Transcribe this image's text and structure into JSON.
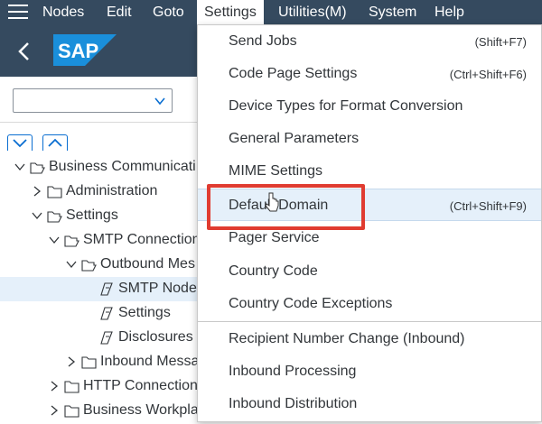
{
  "menubar": {
    "items": [
      {
        "label": "Nodes"
      },
      {
        "label": "Edit"
      },
      {
        "label": "Goto"
      },
      {
        "label": "Settings"
      },
      {
        "label": "Utilities(M)"
      },
      {
        "label": "System"
      },
      {
        "label": "Help"
      }
    ]
  },
  "header": {
    "logo_text": "SAP",
    "brand_color": "#1a8fdb"
  },
  "filter": {
    "selected_value": ""
  },
  "tree": {
    "items": [
      {
        "label": "Business Communicati"
      },
      {
        "label": "Administration"
      },
      {
        "label": "Settings"
      },
      {
        "label": "SMTP Connection"
      },
      {
        "label": "Outbound Mes"
      },
      {
        "label": "SMTP Node"
      },
      {
        "label": "Settings"
      },
      {
        "label": "Disclosures"
      },
      {
        "label": "Inbound Messa"
      },
      {
        "label": "HTTP Connection"
      },
      {
        "label": "Business Workpla"
      }
    ]
  },
  "settings_menu": {
    "items": [
      {
        "label": "Send Jobs",
        "shortcut": "(Shift+F7)"
      },
      {
        "label": "Code Page Settings",
        "shortcut": "(Ctrl+Shift+F6)"
      },
      {
        "label": "Device Types for Format Conversion",
        "shortcut": ""
      },
      {
        "label": "General Parameters",
        "shortcut": ""
      },
      {
        "label": "MIME Settings",
        "shortcut": ""
      },
      {
        "label": "Default Domain",
        "shortcut": "(Ctrl+Shift+F9)"
      },
      {
        "label": "Pager Service",
        "shortcut": ""
      },
      {
        "label": "Country Code",
        "shortcut": ""
      },
      {
        "label": "Country Code Exceptions",
        "shortcut": ""
      },
      {
        "label": "Recipient Number Change (Inbound)",
        "shortcut": ""
      },
      {
        "label": "Inbound Processing",
        "shortcut": ""
      },
      {
        "label": "Inbound Distribution",
        "shortcut": ""
      }
    ]
  },
  "colors": {
    "shell": "#354a5f",
    "highlight": "#e03c31",
    "hover": "#e5f0fa"
  }
}
